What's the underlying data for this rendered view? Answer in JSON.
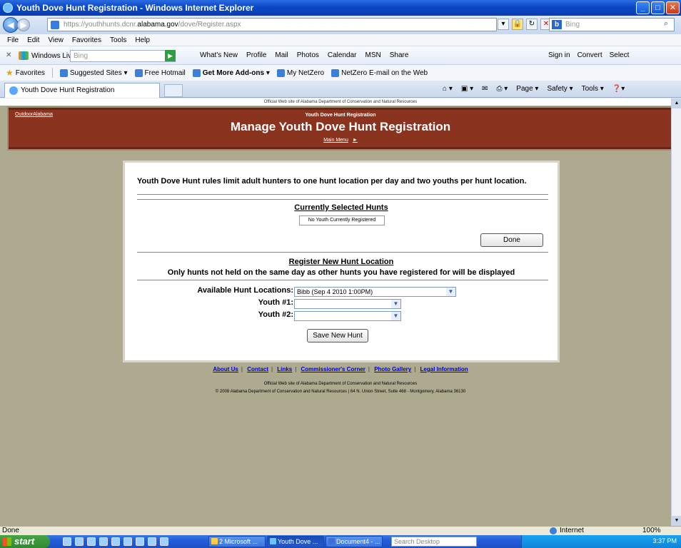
{
  "browser": {
    "window_title": "Youth Dove Hunt Registration - Windows Internet Explorer",
    "url_prefix": "https://youthhunts.dcnr.",
    "url_host": "alabama.gov",
    "url_path": "/dove/Register.aspx",
    "search_placeholder": "Bing",
    "search_logo": "b",
    "menu": [
      "File",
      "Edit",
      "View",
      "Favorites",
      "Tools",
      "Help"
    ],
    "live_toolbar": {
      "brand": "Windows Live",
      "search_placeholder": "Bing",
      "links": [
        "What's New",
        "Profile",
        "Mail",
        "Photos",
        "Calendar",
        "MSN",
        "Share"
      ],
      "sign_in": "Sign in",
      "convert": "Convert",
      "select": "Select"
    },
    "favorites_bar": {
      "favorites": "Favorites",
      "items": [
        "Suggested Sites ▾",
        "Free Hotmail",
        "Get More Add-ons ▾",
        "My NetZero",
        "NetZero E-mail on the Web"
      ]
    },
    "tab_title": "Youth Dove Hunt Registration",
    "command_bar": [
      "Page ▾",
      "Safety ▾",
      "Tools ▾"
    ],
    "status_left": "Done",
    "status_zone": "Internet",
    "status_zoom": "100%"
  },
  "page": {
    "official_header": "Official Web site of Alabama Department of Conservation and Natural Resources",
    "brand_link": "OutdoorAlabama",
    "banner_subtitle": "Youth Dove Hunt Registration",
    "banner_title": "Manage Youth Dove Hunt Registration",
    "main_menu_link": "Main Menu",
    "rules_text": "Youth Dove Hunt rules limit adult hunters to one hunt location per day and two youths per hunt location.",
    "current_section_title": "Currently Selected Hunts",
    "no_youth_text": "No Youth Currently Registered",
    "done_button": "Done",
    "register_section_title": "Register New Hunt Location",
    "only_hunts_text": "Only hunts not held on the same day as other hunts you have registered for will be displayed",
    "form": {
      "location_label": "Available Hunt Locations:",
      "location_value": "Bibb (Sep 4 2010 1:00PM)",
      "youth1_label": "Youth #1:",
      "youth1_value": "",
      "youth2_label": "Youth #2:",
      "youth2_value": ""
    },
    "save_button": "Save New Hunt",
    "footer_links": [
      "About Us",
      "Contact",
      "Links",
      "Commissioner's Corner",
      "Photo Gallery",
      "Legal Information"
    ],
    "footer_line1": "Official Web site of Alabama Department of Conservation and Natural Resources",
    "footer_line2": "© 2008 Alabama Department of Conservation and Natural Resources  |  64 N. Union Street, Suite 468 - Montgomery, Alabama 36130"
  },
  "taskbar": {
    "start_label": "start",
    "tasks": [
      "2 Microsoft ...",
      "Youth Dove ...",
      "Document4 - ..."
    ],
    "desktop_search_placeholder": "Search Desktop",
    "clock": "3:37 PM"
  }
}
